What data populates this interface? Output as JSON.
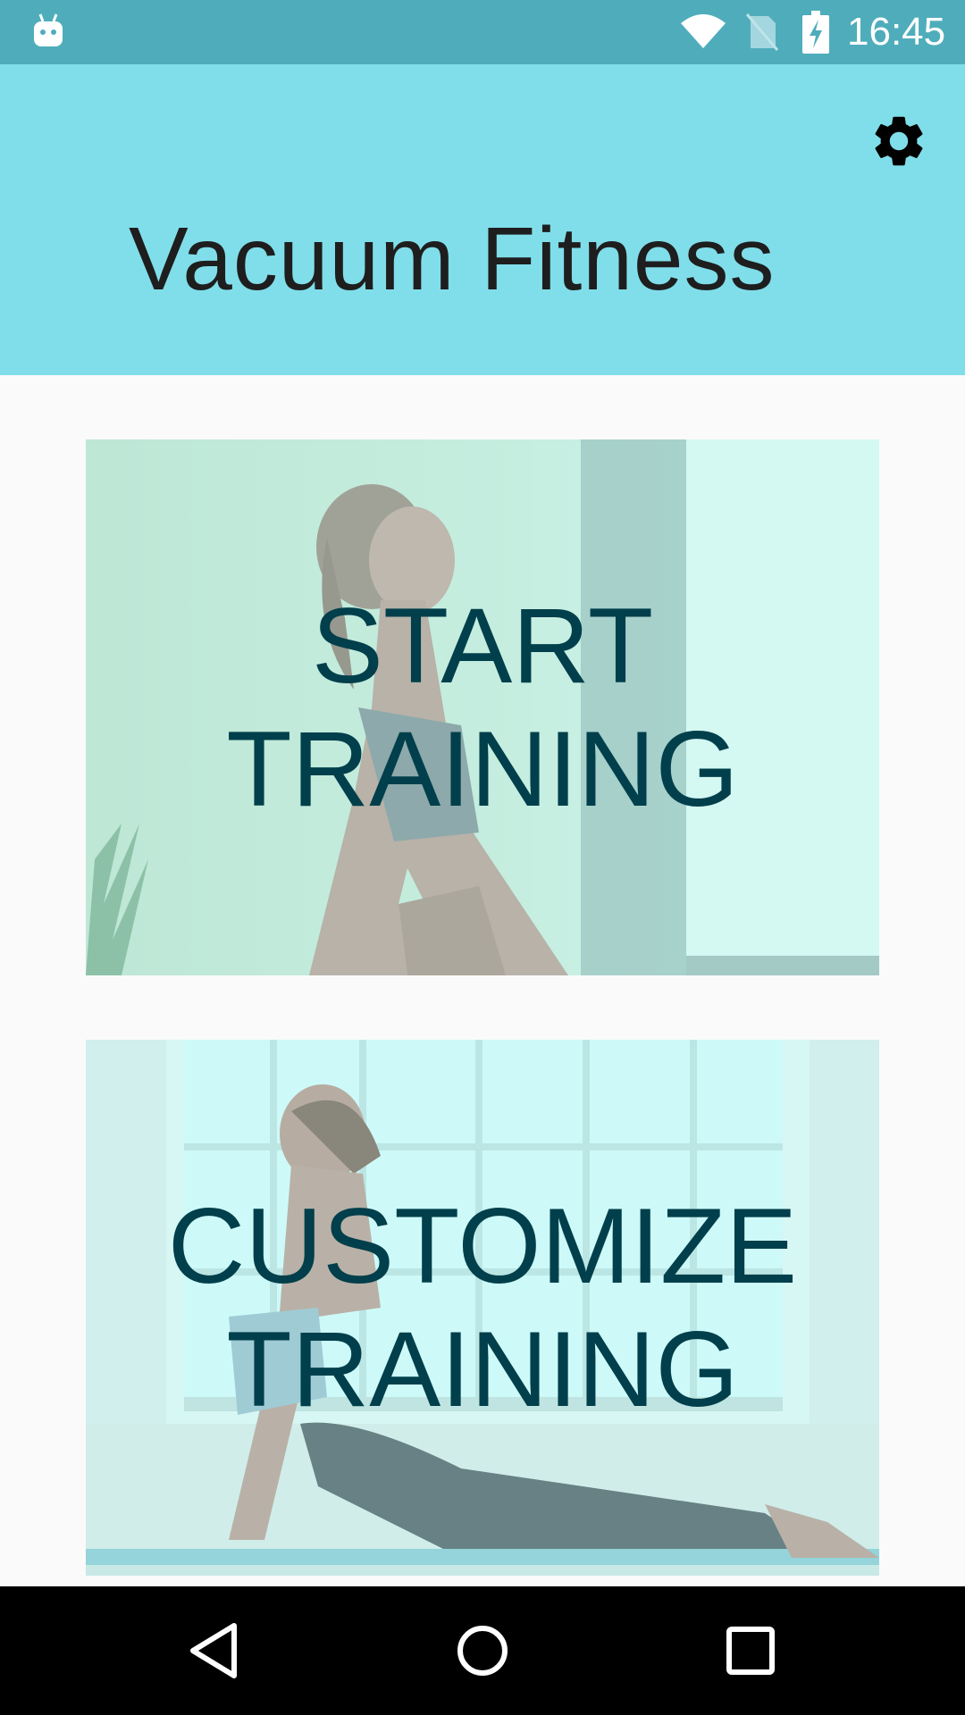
{
  "status_bar": {
    "time": "16:45",
    "icons": [
      "android-icon",
      "wifi-icon",
      "no-sim-icon",
      "battery-charging-icon"
    ]
  },
  "app_bar": {
    "title": "Vacuum Fitness",
    "settings_icon": "gear-icon"
  },
  "cards": {
    "start": {
      "line1": "START",
      "line2": "TRAINING"
    },
    "customize": {
      "line1": "CUSTOMIZE",
      "line2": "TRAINING"
    }
  },
  "nav_bar": {
    "icons": [
      "back-icon",
      "home-icon",
      "recents-icon"
    ]
  },
  "colors": {
    "status_bar": "#4fadbb",
    "app_bar": "#80deea",
    "card_text": "#003f4b",
    "background": "#fafafa"
  }
}
